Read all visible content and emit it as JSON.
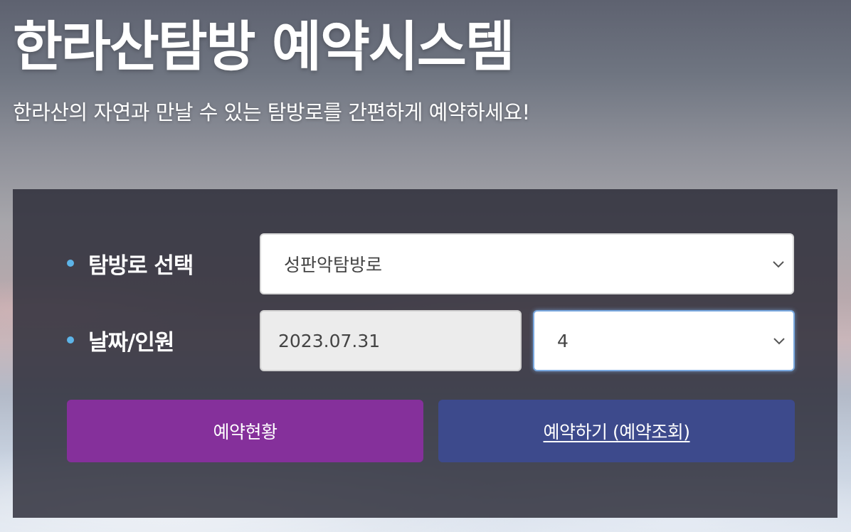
{
  "hero": {
    "title": "한라산탐방 예약시스템",
    "subtitle": "한라산의 자연과 만날 수 있는 탐방로를 간편하게 예약하세요!"
  },
  "form": {
    "course_label": "탐방로 선택",
    "course_value": "성판악탐방로",
    "date_people_label": "날짜/인원",
    "date_value": "2023.07.31",
    "people_value": "4"
  },
  "buttons": {
    "status_label": "예약현황",
    "reserve_label": "예약하기 (예약조회)"
  },
  "colors": {
    "bullet": "#5db4e8",
    "status_button": "#85309b",
    "reserve_button": "#3d4a8c",
    "panel": "rgba(40,40,52,0.82)",
    "focus_border": "#7aa9e0"
  },
  "icons": {
    "bullet": "dot-bullet-icon",
    "dropdown": "chevron-down-icon"
  }
}
